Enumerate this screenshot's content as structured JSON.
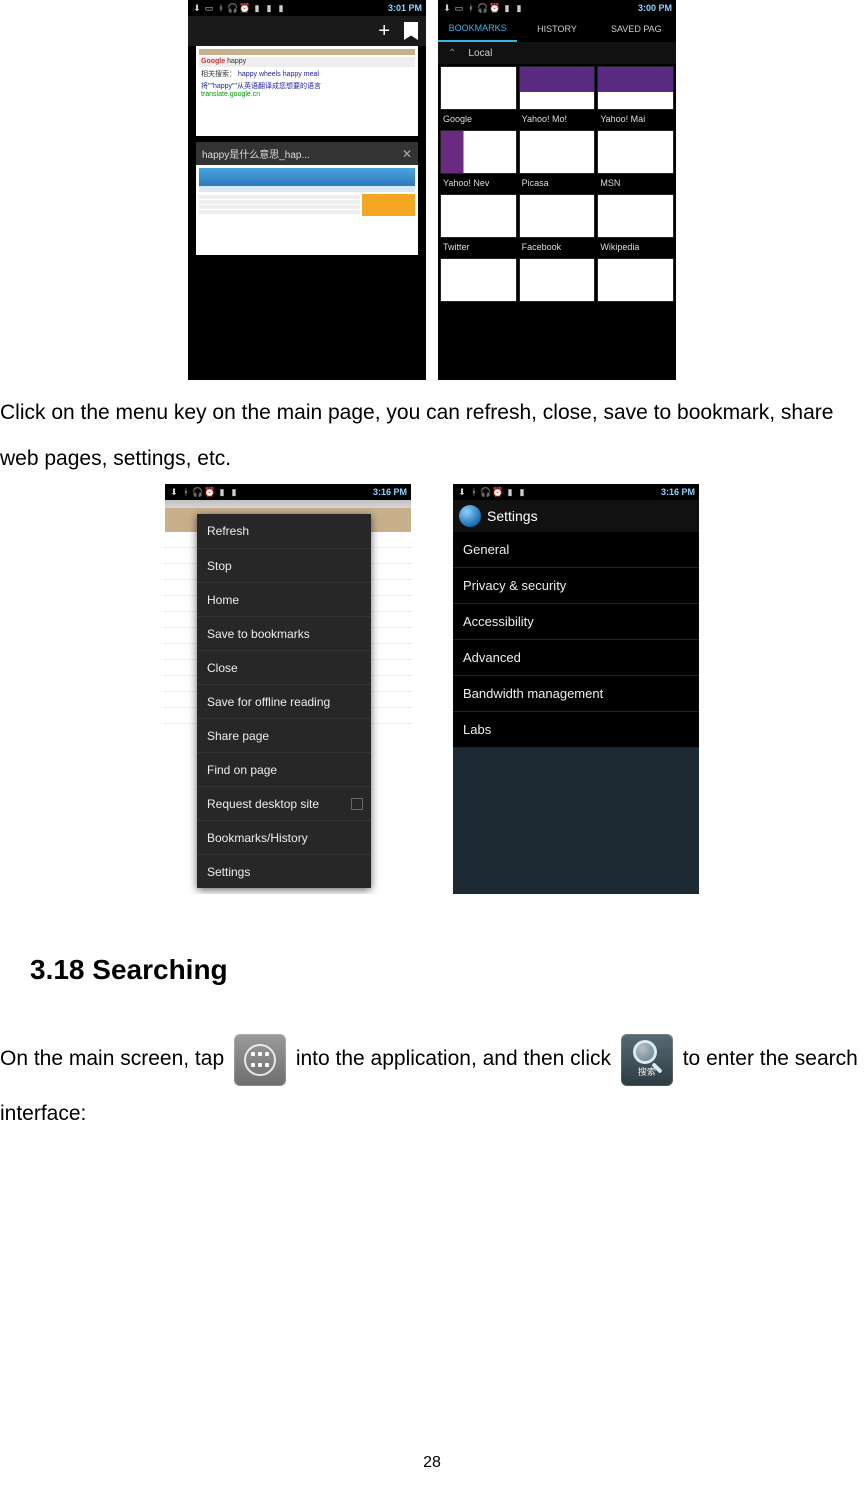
{
  "statusbar": {
    "time1": "3:01 PM",
    "time2": "3:00 PM",
    "time3": "3:16 PM"
  },
  "phone1": {
    "tab1_title": "happy",
    "preview_related_label": "相关搜索：",
    "preview_related_1": "happy wheels",
    "preview_related_2": "happy meal",
    "preview_translate": "将\"\"happy\"\"从英语翻译成您想要的语言",
    "preview_translate_link": "translate.google.cn",
    "tab2_title": "happy是什么意思_hap..."
  },
  "phone2_bm": {
    "tab_bookmarks": "BOOKMARKS",
    "tab_history": "HISTORY",
    "tab_saved": "SAVED PAG",
    "local": "Local",
    "items": [
      "Google",
      "Yahoo! Mo!",
      "Yahoo! Mai",
      "Yahoo! Nev",
      "Picasa",
      "MSN",
      "Twitter",
      "Facebook",
      "Wikipedia"
    ]
  },
  "body1": "Click on the menu key on the main page, you can refresh, close, save to bookmark, share web pages, settings, etc.",
  "phone3_menu": [
    "Refresh",
    "Stop",
    "Home",
    "Save to bookmarks",
    "Close",
    "Save for offline reading",
    "Share page",
    "Find on page",
    "Request desktop site",
    "Bookmarks/History",
    "Settings"
  ],
  "phone4": {
    "title": "Settings",
    "items": [
      "General",
      "Privacy & security",
      "Accessibility",
      "Advanced",
      "Bandwidth management",
      "Labs"
    ]
  },
  "heading": "3.18 Searching",
  "para2": {
    "s1": "On the main screen, tap",
    "s2": "into the application, and then click",
    "s3": "to enter the search interface:",
    "search_label": "搜索"
  },
  "pagenum": "28"
}
